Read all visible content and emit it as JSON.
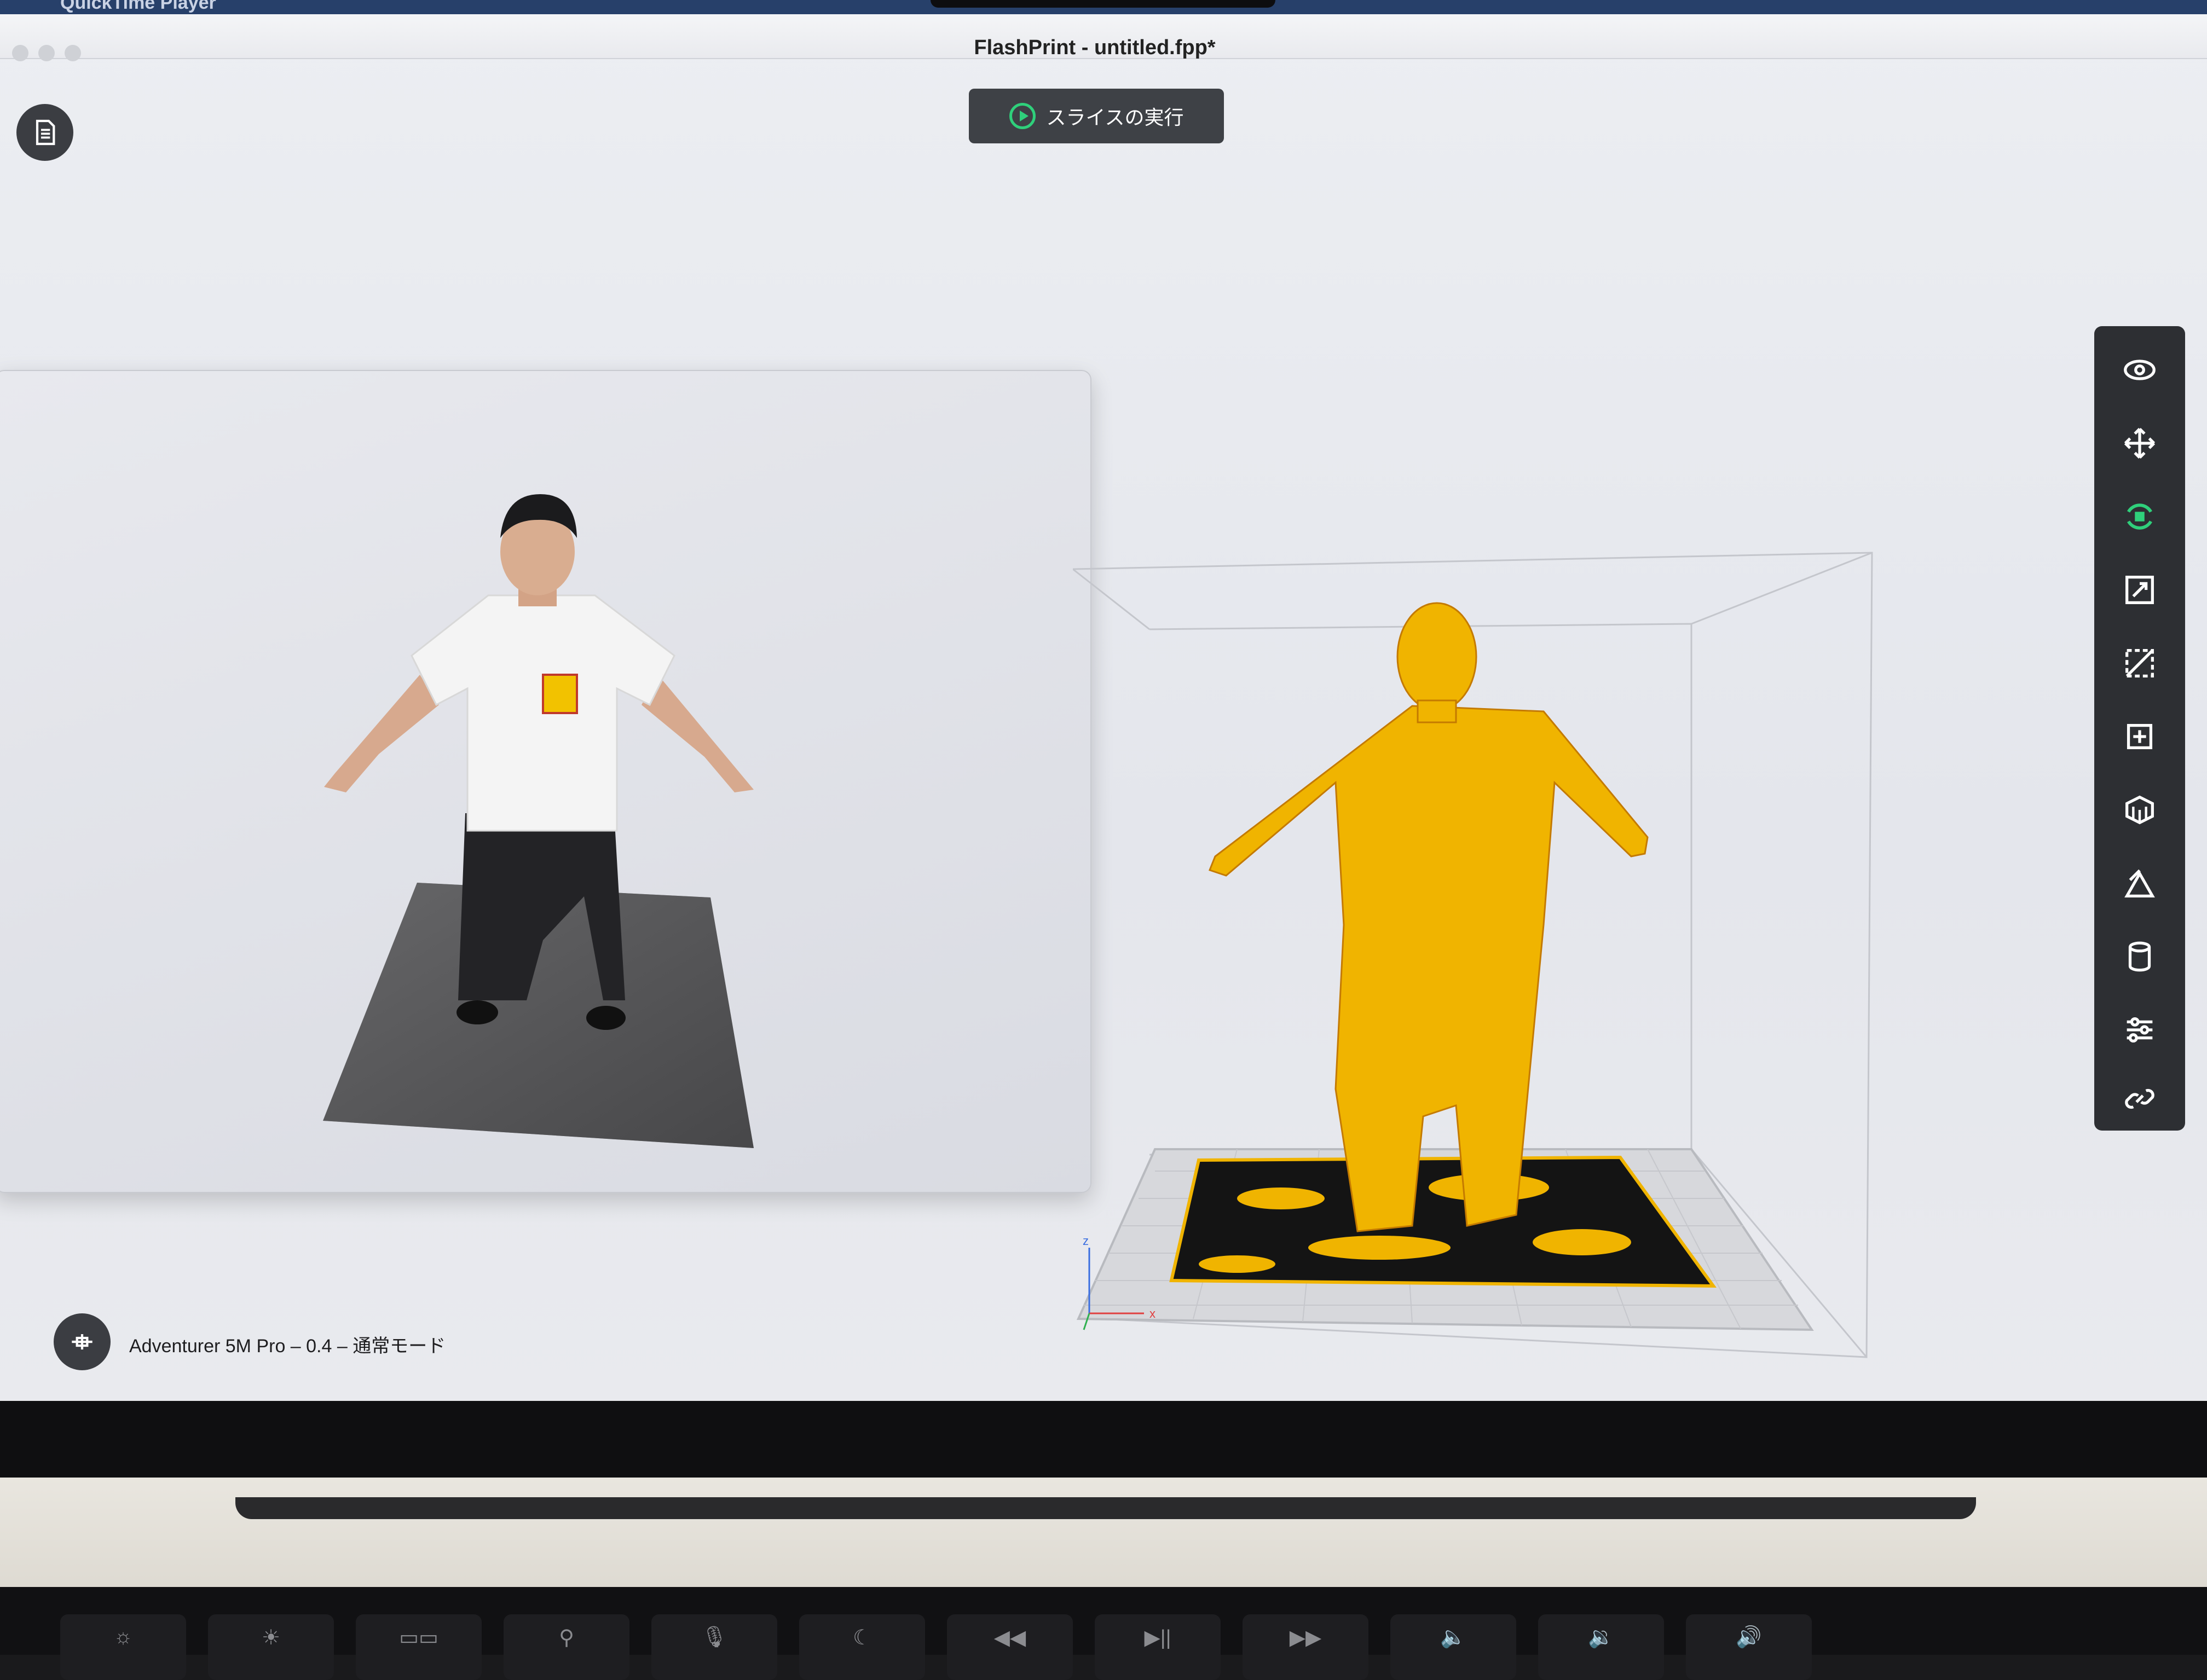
{
  "menubar": {
    "app_name": "QuickTime Player"
  },
  "window": {
    "title": "FlashPrint - untitled.fpp*"
  },
  "toolbar_top": {
    "slice_label": "スライスの実行"
  },
  "status_bar": {
    "printer_text": "Adventurer 5M Pro – 0.4 – 通常モード"
  },
  "right_toolbar": {
    "tools": [
      "eye-icon",
      "move-icon",
      "rotate-icon",
      "scale-icon",
      "cut-icon",
      "add-model-icon",
      "support-icon",
      "mirror-icon",
      "cylinder-icon",
      "settings-sliders-icon",
      "link-icon"
    ],
    "active_tool": "rotate-icon",
    "active_color": "#2fd07b"
  },
  "viewport": {
    "axis_labels": {
      "x": "x",
      "y": "y",
      "z": "z"
    },
    "model_color": "#f0b400"
  },
  "keyboard": {
    "keys": [
      "☼",
      "☀",
      "▭▭",
      "⚲",
      "🎙",
      "☾",
      "◀◀",
      "▶||",
      "▶▶",
      "🔈",
      "🔉",
      "🔊"
    ]
  }
}
